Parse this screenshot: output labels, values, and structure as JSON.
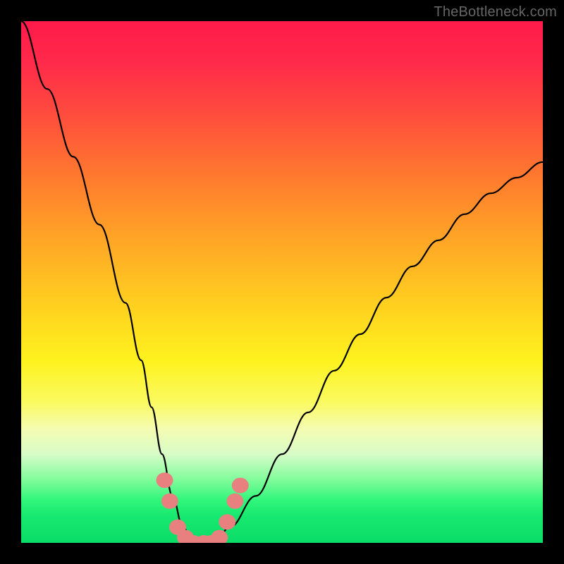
{
  "watermark": "TheBottleneck.com",
  "chart_data": {
    "type": "line",
    "title": "",
    "xlabel": "",
    "ylabel": "",
    "xlim": [
      0,
      100
    ],
    "ylim": [
      0,
      100
    ],
    "grid": false,
    "series": [
      {
        "name": "curve",
        "x": [
          0,
          5,
          10,
          15,
          20,
          23,
          25,
          27,
          29,
          31,
          33,
          35,
          37,
          40,
          45,
          50,
          55,
          60,
          65,
          70,
          75,
          80,
          85,
          90,
          95,
          100
        ],
        "values": [
          100,
          87,
          74,
          61,
          46,
          35,
          26,
          17,
          9,
          3,
          0,
          0,
          0,
          3,
          9,
          17,
          25,
          33,
          40,
          47,
          53,
          58,
          63,
          67,
          70,
          73
        ]
      }
    ],
    "markers": [
      {
        "x": 27.5,
        "y": 12
      },
      {
        "x": 28.5,
        "y": 8
      },
      {
        "x": 30.0,
        "y": 3
      },
      {
        "x": 31.5,
        "y": 1
      },
      {
        "x": 33.0,
        "y": 0
      },
      {
        "x": 35.0,
        "y": 0
      },
      {
        "x": 36.5,
        "y": 0
      },
      {
        "x": 38.0,
        "y": 1
      },
      {
        "x": 39.5,
        "y": 4
      },
      {
        "x": 41.0,
        "y": 8
      },
      {
        "x": 42.0,
        "y": 11
      }
    ],
    "gradient_stops": [
      {
        "pos": 0,
        "color": "#ff1a4a"
      },
      {
        "pos": 50,
        "color": "#ffd21f"
      },
      {
        "pos": 80,
        "color": "#f5fcb0"
      },
      {
        "pos": 100,
        "color": "#0add68"
      }
    ]
  }
}
